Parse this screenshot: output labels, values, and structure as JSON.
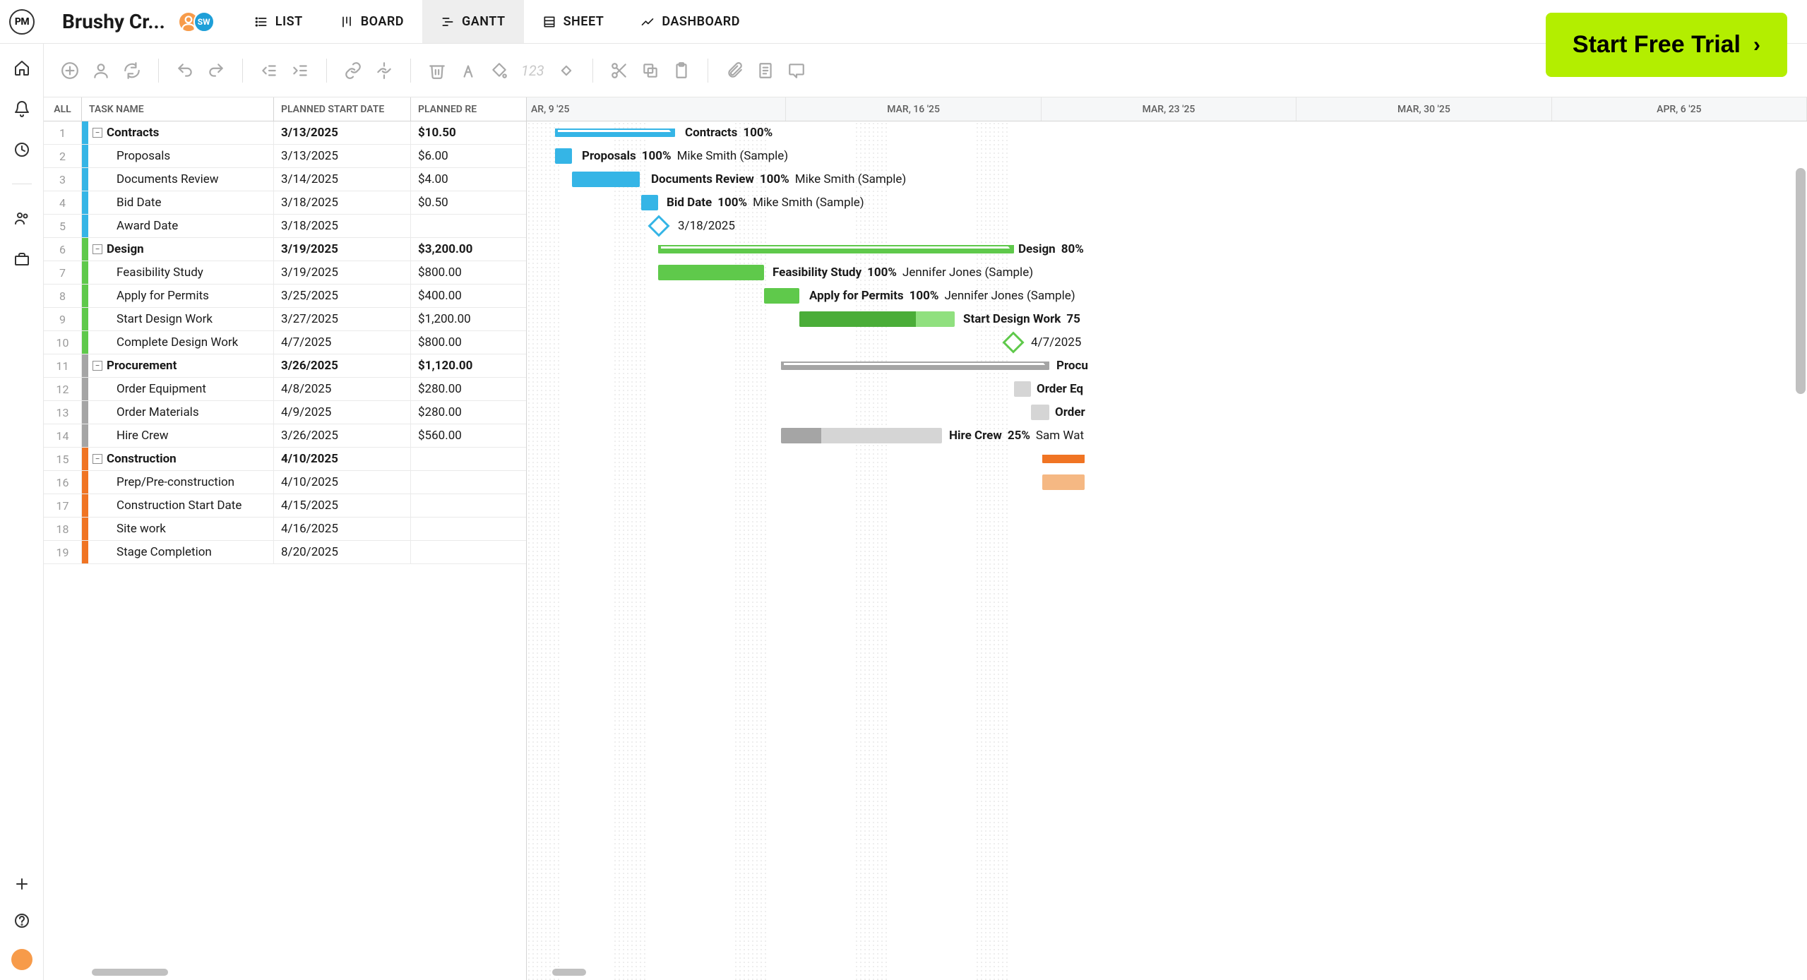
{
  "logoText": "PM",
  "projectTitle": "Brushy Cr...",
  "avatars": [
    {
      "initials": "",
      "type": "photo"
    },
    {
      "initials": "SW",
      "type": "sw"
    }
  ],
  "viewTabs": [
    {
      "label": "LIST",
      "icon": "list"
    },
    {
      "label": "BOARD",
      "icon": "board"
    },
    {
      "label": "GANTT",
      "icon": "gantt",
      "active": true
    },
    {
      "label": "SHEET",
      "icon": "sheet"
    },
    {
      "label": "DASHBOARD",
      "icon": "dashboard"
    }
  ],
  "cta": "Start Free Trial",
  "gridHeaders": {
    "all": "ALL",
    "name": "TASK NAME",
    "start": "PLANNED START DATE",
    "cost": "PLANNED RE"
  },
  "timeline": [
    "AR, 9 '25",
    "MAR, 16 '25",
    "MAR, 23 '25",
    "MAR, 30 '25",
    "APR, 6 '25"
  ],
  "toolbarNumber": "123",
  "tasks": [
    {
      "num": 1,
      "name": "Contracts",
      "date": "3/13/2025",
      "cost": "$10.50",
      "summary": true,
      "color": "blue"
    },
    {
      "num": 2,
      "name": "Proposals",
      "date": "3/13/2025",
      "cost": "$6.00",
      "summary": false,
      "color": "blue"
    },
    {
      "num": 3,
      "name": "Documents Review",
      "date": "3/14/2025",
      "cost": "$4.00",
      "summary": false,
      "color": "blue"
    },
    {
      "num": 4,
      "name": "Bid Date",
      "date": "3/18/2025",
      "cost": "$0.50",
      "summary": false,
      "color": "blue"
    },
    {
      "num": 5,
      "name": "Award Date",
      "date": "3/18/2025",
      "cost": "",
      "summary": false,
      "color": "blue"
    },
    {
      "num": 6,
      "name": "Design",
      "date": "3/19/2025",
      "cost": "$3,200.00",
      "summary": true,
      "color": "green"
    },
    {
      "num": 7,
      "name": "Feasibility Study",
      "date": "3/19/2025",
      "cost": "$800.00",
      "summary": false,
      "color": "green"
    },
    {
      "num": 8,
      "name": "Apply for Permits",
      "date": "3/25/2025",
      "cost": "$400.00",
      "summary": false,
      "color": "green"
    },
    {
      "num": 9,
      "name": "Start Design Work",
      "date": "3/27/2025",
      "cost": "$1,200.00",
      "summary": false,
      "color": "green"
    },
    {
      "num": 10,
      "name": "Complete Design Work",
      "date": "4/7/2025",
      "cost": "$800.00",
      "summary": false,
      "color": "green"
    },
    {
      "num": 11,
      "name": "Procurement",
      "date": "3/26/2025",
      "cost": "$1,120.00",
      "summary": true,
      "color": "gray"
    },
    {
      "num": 12,
      "name": "Order Equipment",
      "date": "4/8/2025",
      "cost": "$280.00",
      "summary": false,
      "color": "gray"
    },
    {
      "num": 13,
      "name": "Order Materials",
      "date": "4/9/2025",
      "cost": "$280.00",
      "summary": false,
      "color": "gray"
    },
    {
      "num": 14,
      "name": "Hire Crew",
      "date": "3/26/2025",
      "cost": "$560.00",
      "summary": false,
      "color": "gray"
    },
    {
      "num": 15,
      "name": "Construction",
      "date": "4/10/2025",
      "cost": "",
      "summary": true,
      "color": "orange"
    },
    {
      "num": 16,
      "name": "Prep/Pre-construction",
      "date": "4/10/2025",
      "cost": "",
      "summary": false,
      "color": "orange"
    },
    {
      "num": 17,
      "name": "Construction Start Date",
      "date": "4/15/2025",
      "cost": "",
      "summary": false,
      "color": "orange"
    },
    {
      "num": 18,
      "name": "Site work",
      "date": "4/16/2025",
      "cost": "",
      "summary": false,
      "color": "orange"
    },
    {
      "num": 19,
      "name": "Stage Completion",
      "date": "8/20/2025",
      "cost": "",
      "summary": false,
      "color": "orange"
    }
  ],
  "ganttLabels": {
    "contracts": {
      "title": "Contracts",
      "pct": "100%"
    },
    "proposals": {
      "title": "Proposals",
      "pct": "100%",
      "assignee": "Mike Smith (Sample)"
    },
    "documents": {
      "title": "Documents Review",
      "pct": "100%",
      "assignee": "Mike Smith (Sample)"
    },
    "bidDate": {
      "title": "Bid Date",
      "pct": "100%",
      "assignee": "Mike Smith (Sample)"
    },
    "awardDate": {
      "date": "3/18/2025"
    },
    "design": {
      "title": "Design",
      "pct": "80%"
    },
    "feasibility": {
      "title": "Feasibility Study",
      "pct": "100%",
      "assignee": "Jennifer Jones (Sample)"
    },
    "permits": {
      "title": "Apply for Permits",
      "pct": "100%",
      "assignee": "Jennifer Jones (Sample)"
    },
    "startDesign": {
      "title": "Start Design Work",
      "pct": "75"
    },
    "completeDesign": {
      "date": "4/7/2025"
    },
    "procurement": {
      "title": "Procu"
    },
    "orderEquip": {
      "title": "Order Eq"
    },
    "orderMat": {
      "title": "Order"
    },
    "hireCrew": {
      "title": "Hire Crew",
      "pct": "25%",
      "assignee": "Sam Wat"
    }
  }
}
